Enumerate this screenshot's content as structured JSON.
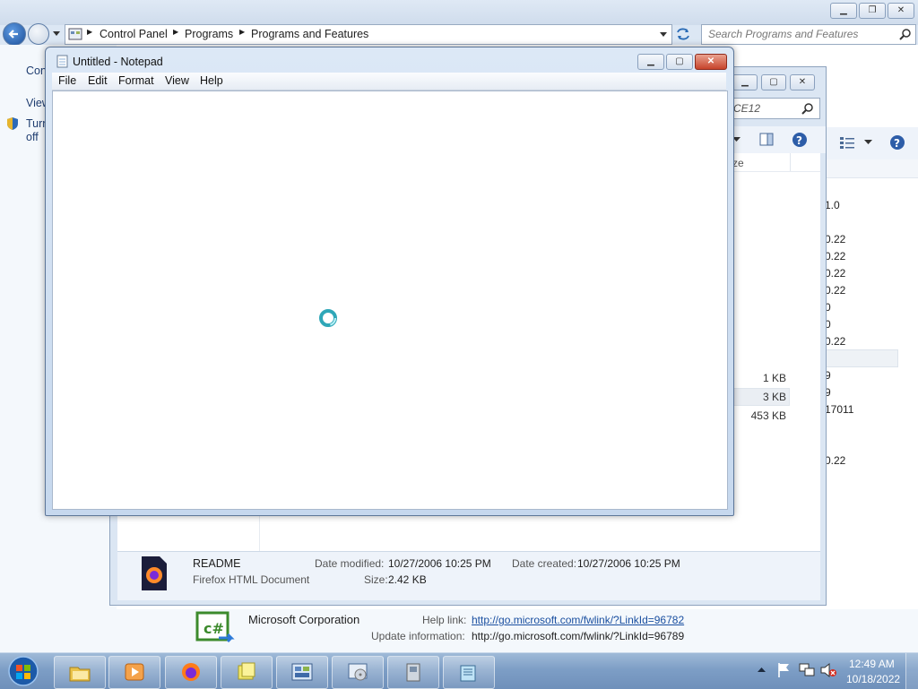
{
  "control_panel": {
    "breadcrumb": [
      "Control Panel",
      "Programs",
      "Programs and Features"
    ],
    "search_placeholder": "Search Programs and Features",
    "left_nav": {
      "item1": "Con",
      "item2": "View",
      "item3": "Turn",
      "item4": "off"
    },
    "publisher_info": {
      "publisher": "Microsoft Corporation",
      "help_link_label": "Help link:",
      "help_link": "http://go.microsoft.com/fwlink/?LinkId=96782",
      "update_info_label": "Update information:",
      "update_info": "http://go.microsoft.com/fwlink/?LinkId=96789"
    }
  },
  "explorer": {
    "search_fragment": "CE12",
    "column_fragment": "ze",
    "sizes": [
      "1 KB",
      "3 KB",
      "453 KB"
    ],
    "details": {
      "name": "README",
      "type": "Firefox HTML Document",
      "date_modified_label": "Date modified:",
      "date_modified": "10/27/2006 10:25 PM",
      "size_label": "Size:",
      "size": "2.42 KB",
      "date_created_label": "Date created:",
      "date_created": "10/27/2006 10:25 PM"
    }
  },
  "right_window": {
    "versions": [
      "1.0",
      "0.22",
      "0.22",
      "0.22",
      "0.22",
      "0",
      "0",
      "0.22",
      "9",
      "9",
      "17011",
      "0.22"
    ]
  },
  "notepad": {
    "title": "Untitled - Notepad",
    "menu": [
      "File",
      "Edit",
      "Format",
      "View",
      "Help"
    ]
  },
  "taskbar": {
    "time": "12:49 AM",
    "date": "10/18/2022"
  }
}
